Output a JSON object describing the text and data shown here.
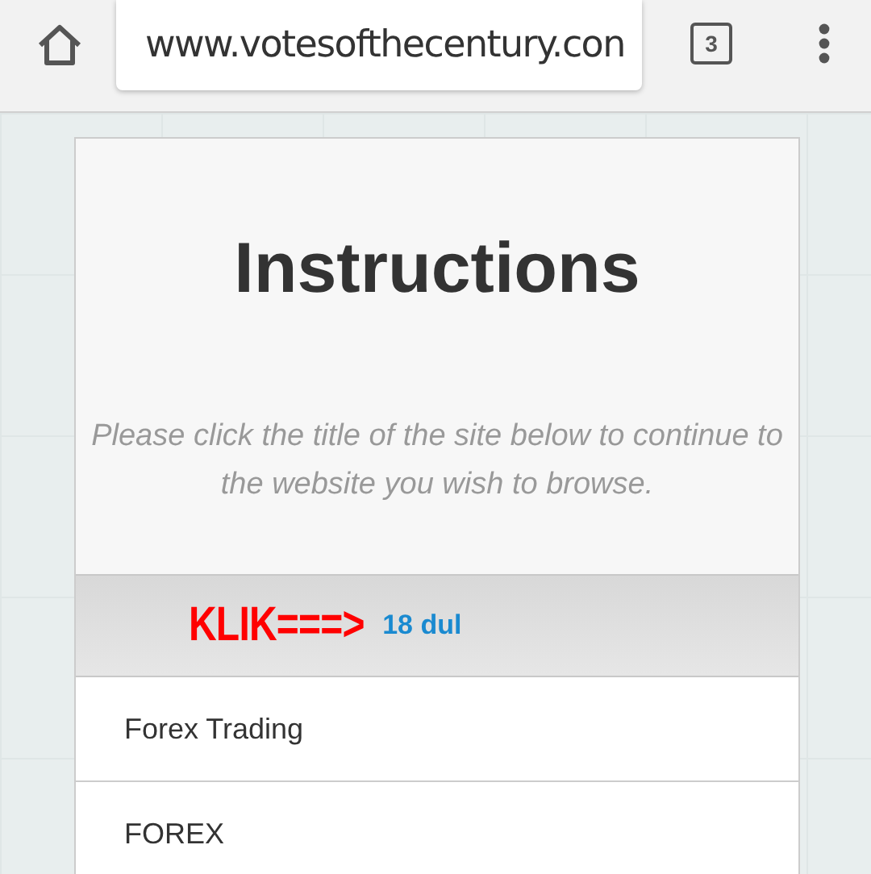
{
  "browser": {
    "url": "www.votesofthecentury.con",
    "tab_count": "3"
  },
  "page": {
    "title": "Instructions",
    "subtitle": "Please click the title of the site below to continue to the website you wish to browse.",
    "banner": {
      "klik": "KLIK===>",
      "label": "18 dul"
    },
    "links": [
      {
        "label": "Forex Trading"
      },
      {
        "label": "FOREX"
      }
    ]
  }
}
